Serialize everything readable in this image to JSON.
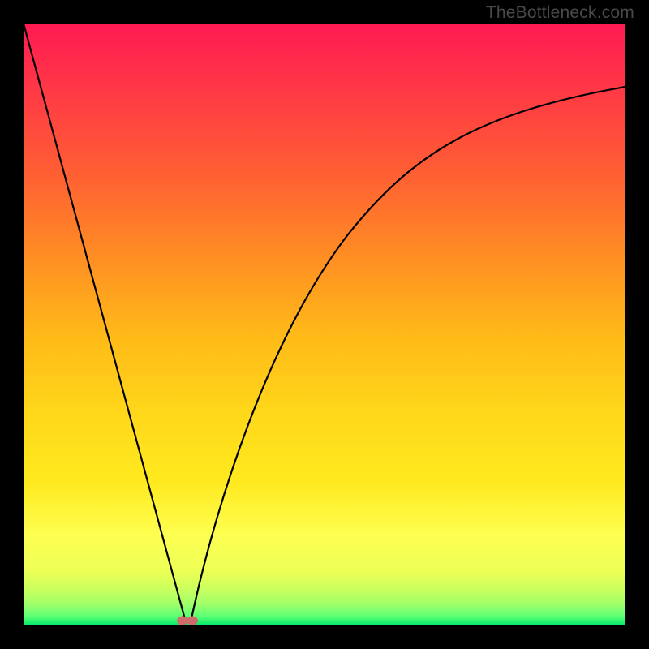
{
  "watermark": "TheBottleneck.com",
  "chart_data": {
    "type": "line",
    "title": "",
    "xlabel": "",
    "ylabel": "",
    "xlim": [
      0,
      1
    ],
    "ylim": [
      0,
      1
    ],
    "background_gradient": {
      "type": "vertical",
      "stops": [
        {
          "pos": 0.0,
          "color": "#ff1a53"
        },
        {
          "pos": 0.25,
          "color": "#ff5f33"
        },
        {
          "pos": 0.5,
          "color": "#ffba18"
        },
        {
          "pos": 0.7,
          "color": "#ffe91e"
        },
        {
          "pos": 0.85,
          "color": "#fdff51"
        },
        {
          "pos": 0.93,
          "color": "#d8ff5a"
        },
        {
          "pos": 0.97,
          "color": "#8eff75"
        },
        {
          "pos": 1.0,
          "color": "#00e86b"
        }
      ]
    },
    "series": [
      {
        "name": "left-branch",
        "description": "steep descending line from top-left toward minimum",
        "x": [
          0.0,
          0.27
        ],
        "y": [
          1.0,
          0.0
        ]
      },
      {
        "name": "right-branch",
        "description": "rising saturating curve from minimum toward upper-right",
        "x": [
          0.27,
          0.3,
          0.35,
          0.4,
          0.45,
          0.5,
          0.55,
          0.6,
          0.65,
          0.7,
          0.75,
          0.8,
          0.85,
          0.9,
          0.95,
          1.0
        ],
        "y": [
          0.0,
          0.13,
          0.29,
          0.41,
          0.5,
          0.58,
          0.64,
          0.69,
          0.73,
          0.77,
          0.8,
          0.82,
          0.84,
          0.86,
          0.875,
          0.89
        ]
      }
    ],
    "marker": {
      "name": "minimum-point",
      "x": 0.27,
      "y": 0.005,
      "color": "#d06a6a",
      "shape": "double-dot"
    }
  }
}
